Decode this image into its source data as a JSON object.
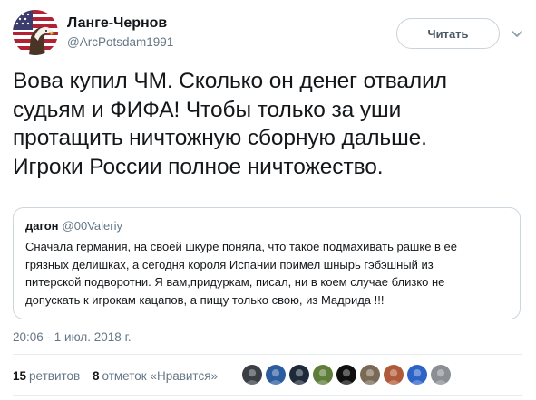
{
  "author": {
    "display_name": "Ланге-Чернов",
    "handle": "@ArcPotsdam1991",
    "avatar_icon": "flag-eagle-avatar-icon"
  },
  "follow_label": "Читать",
  "tweet": {
    "lines": [
      "Вова купил ЧМ. Сколько он денег отвалил",
      "судьям и ФИФА! Чтобы только за уши",
      "протащить ничтожную сборную дальше.",
      "Игроки России полное ничтожество."
    ]
  },
  "quote": {
    "name": "дагон",
    "handle": "@00Valeriy",
    "lines": [
      "Сначала германия, на своей шкуре поняла, что такое подмахивать рашке в её",
      "грязных делишках, а сегодня короля Испании поимел шныpь гэбэшный из",
      "питерской подворотни. Я вам,придуркам, писал, ни в коем случае близко не",
      "допускать к игрокам кацапов, а пищу только свою, из Мадрида !!!"
    ]
  },
  "timestamp": "20:06 - 1 июл. 2018 г.",
  "stats": {
    "retweets_count": "15",
    "retweets_label": "ретвитов",
    "likes_count": "8",
    "likes_label": "отметок «Нравится»"
  },
  "likers": [
    {
      "icon": "liker-avatar-1-icon",
      "color": "#3a3f45"
    },
    {
      "icon": "liker-avatar-2-icon",
      "color": "#2b5c9e"
    },
    {
      "icon": "liker-avatar-3-icon",
      "color": "#1e2a3a"
    },
    {
      "icon": "liker-avatar-4-icon",
      "color": "#5e7d3a"
    },
    {
      "icon": "liker-avatar-5-icon",
      "color": "#0f0f0f"
    },
    {
      "icon": "liker-avatar-6-icon",
      "color": "#7a6a55"
    },
    {
      "icon": "liker-avatar-7-icon",
      "color": "#b05a3a"
    },
    {
      "icon": "liker-avatar-8-icon",
      "color": "#2d63c7"
    },
    {
      "icon": "liker-avatar-9-icon",
      "color": "#8a8f93"
    }
  ]
}
